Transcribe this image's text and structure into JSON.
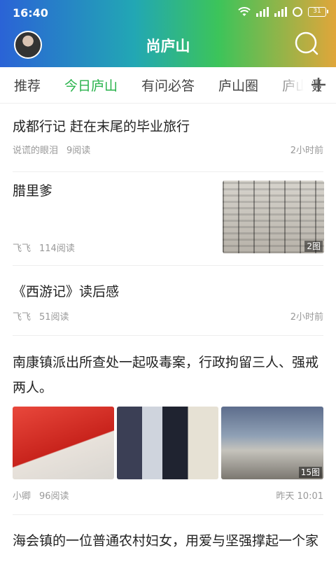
{
  "status_bar": {
    "time": "16:40",
    "battery": "31"
  },
  "header": {
    "title": "尚庐山",
    "avatar": "avatar",
    "search_icon": "search-icon"
  },
  "tabs": [
    {
      "label": "推荐",
      "active": false
    },
    {
      "label": "今日庐山",
      "active": true
    },
    {
      "label": "有问必答",
      "active": false
    },
    {
      "label": "庐山圈",
      "active": false
    },
    {
      "label": "庐山摄",
      "active": false
    }
  ],
  "colors": {
    "accent": "#27b24a",
    "meta": "#999999"
  },
  "feed": [
    {
      "title": "成都行记 赶在末尾的毕业旅行",
      "author": "说谎的眼泪",
      "reads": "9阅读",
      "time": "2小时前"
    },
    {
      "title": "腊里爹",
      "author": "飞飞",
      "reads": "114阅读",
      "time": "",
      "image_count": "2图"
    },
    {
      "title": "《西游记》读后感",
      "author": "飞飞",
      "reads": "51阅读",
      "time": "2小时前"
    },
    {
      "title": "南康镇派出所查处一起吸毒案，行政拘留三人、强戒两人。",
      "author": "小卿",
      "reads": "96阅读",
      "time": "昨天 10:01",
      "image_count": "15图"
    },
    {
      "title": "海会镇的一位普通农村妇女，用爱与坚强撑起一个家"
    }
  ]
}
